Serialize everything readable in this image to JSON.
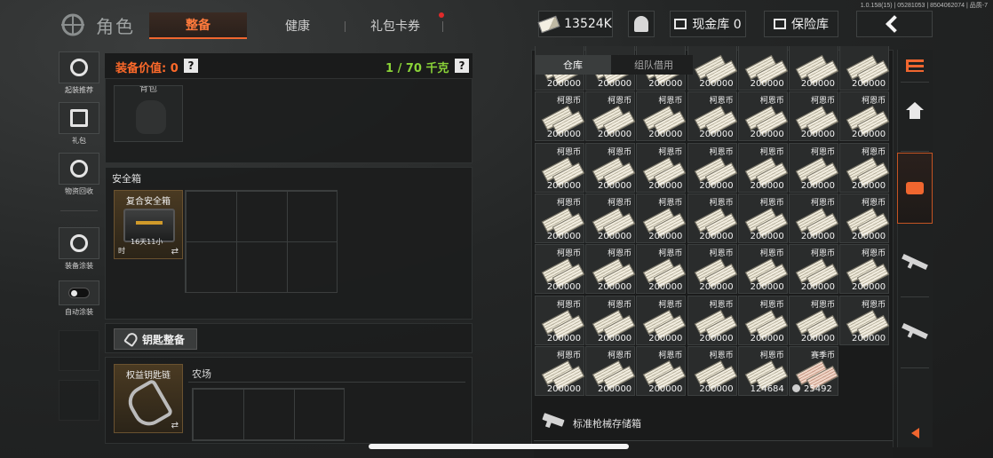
{
  "version": "1.0.158(15) | 05281053 | 8504062074 | 品质-7",
  "header": {
    "title": "角色",
    "tabs": [
      "整备",
      "健康",
      "礼包卡券"
    ],
    "money": "13524K",
    "cash_label": "现金库 0",
    "safe_label": "保险库"
  },
  "left_buttons": [
    "起装推荐",
    "礼包",
    "物资回收",
    "装备涂装",
    "自动涂装"
  ],
  "equipment": {
    "value_label": "装备价值: 0",
    "weight": "1 / 70 千克",
    "bag_label": "背包",
    "safe_section": "安全箱",
    "safe_case_name": "复合安全箱",
    "safe_case_timer": "16天11小",
    "safe_case_timer2": "时",
    "key_button": "钥匙整备",
    "keychain_name": "权益钥匙链",
    "farm_label": "农场",
    "swap": "⇄"
  },
  "storage": {
    "tabs": [
      "仓库",
      "组队借用"
    ],
    "items_name": "柯恩币",
    "items": [
      {
        "amount": "200000",
        "name": ""
      },
      {
        "amount": "200000",
        "name": ""
      },
      {
        "amount": "200000",
        "name": ""
      },
      {
        "amount": "200000",
        "name": ""
      },
      {
        "amount": "200000",
        "name": ""
      },
      {
        "amount": "200000",
        "name": ""
      },
      {
        "amount": "200000",
        "name": ""
      },
      {
        "amount": "200000",
        "name": "柯恩币"
      },
      {
        "amount": "200000",
        "name": "柯恩币"
      },
      {
        "amount": "200000",
        "name": "柯恩币"
      },
      {
        "amount": "200000",
        "name": "柯恩币"
      },
      {
        "amount": "200000",
        "name": "柯恩币"
      },
      {
        "amount": "200000",
        "name": "柯恩币"
      },
      {
        "amount": "200000",
        "name": "柯恩币"
      },
      {
        "amount": "200000",
        "name": "柯恩币"
      },
      {
        "amount": "200000",
        "name": "柯恩币"
      },
      {
        "amount": "200000",
        "name": "柯恩币"
      },
      {
        "amount": "200000",
        "name": "柯恩币"
      },
      {
        "amount": "200000",
        "name": "柯恩币"
      },
      {
        "amount": "200000",
        "name": "柯恩币"
      },
      {
        "amount": "200000",
        "name": "柯恩币"
      },
      {
        "amount": "200000",
        "name": "柯恩币"
      },
      {
        "amount": "200000",
        "name": "柯恩币"
      },
      {
        "amount": "200000",
        "name": "柯恩币"
      },
      {
        "amount": "200000",
        "name": "柯恩币"
      },
      {
        "amount": "200000",
        "name": "柯恩币"
      },
      {
        "amount": "200000",
        "name": "柯恩币"
      },
      {
        "amount": "200000",
        "name": "柯恩币"
      },
      {
        "amount": "200000",
        "name": "柯恩币"
      },
      {
        "amount": "200000",
        "name": "柯恩币"
      },
      {
        "amount": "200000",
        "name": "柯恩币"
      },
      {
        "amount": "200000",
        "name": "柯恩币"
      },
      {
        "amount": "200000",
        "name": "柯恩币"
      },
      {
        "amount": "200000",
        "name": "柯恩币"
      },
      {
        "amount": "200000",
        "name": "柯恩币"
      },
      {
        "amount": "200000",
        "name": "柯恩币"
      },
      {
        "amount": "200000",
        "name": "柯恩币"
      },
      {
        "amount": "200000",
        "name": "柯恩币"
      },
      {
        "amount": "200000",
        "name": "柯恩币"
      },
      {
        "amount": "200000",
        "name": "柯恩币"
      },
      {
        "amount": "200000",
        "name": "柯恩币"
      },
      {
        "amount": "200000",
        "name": "柯恩币"
      },
      {
        "amount": "200000",
        "name": "柯恩币"
      },
      {
        "amount": "200000",
        "name": "柯恩币"
      },
      {
        "amount": "200000",
        "name": "柯恩币"
      },
      {
        "amount": "200000",
        "name": "柯恩币"
      },
      {
        "amount": "124684",
        "name": "柯恩币"
      },
      {
        "amount": "25492",
        "name": "赛季币",
        "season": true
      }
    ],
    "weapon_storage": "标准枪械存储箱"
  },
  "icons": [
    "filter-icon",
    "home-icon",
    "storage-chest-icon",
    "rifle-icon",
    "rifle-icon",
    "collapse-arrow-icon"
  ],
  "colors": {
    "accent": "#f0662f",
    "weight": "#8ad338"
  }
}
